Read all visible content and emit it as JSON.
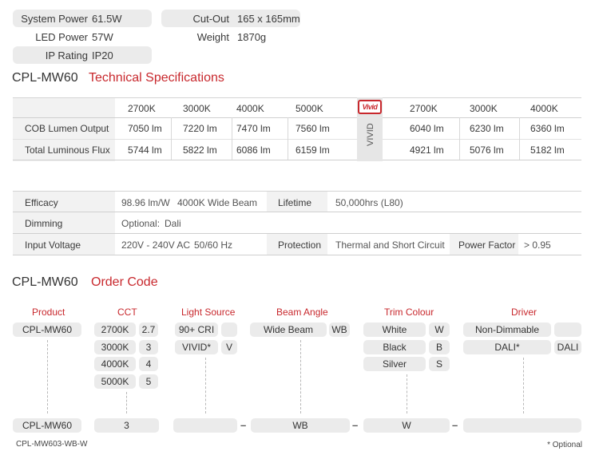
{
  "summary": {
    "system_power_label": "System Power",
    "system_power_value": "61.5W",
    "led_power_label": "LED Power",
    "led_power_value": "57W",
    "ip_rating_label": "IP Rating",
    "ip_rating_value": "IP20",
    "cutout_label": "Cut-Out",
    "cutout_value": "165 x 165mm",
    "weight_label": "Weight",
    "weight_value": "1870g"
  },
  "tech": {
    "model": "CPL-MW60",
    "heading": "Technical Specifications",
    "cct_headers": [
      "2700K",
      "3000K",
      "4000K",
      "5000K"
    ],
    "vivid_logo": "Vivid",
    "vivid_label": "VIVID",
    "vivid_headers": [
      "2700K",
      "3000K",
      "4000K"
    ],
    "rows": [
      {
        "label": "COB Lumen Output",
        "values": [
          "7050 lm",
          "7220 lm",
          "7470 lm",
          "7560 lm"
        ],
        "vivid": [
          "6040 lm",
          "6230 lm",
          "6360 lm"
        ]
      },
      {
        "label": "Total Luminous Flux",
        "values": [
          "5744 lm",
          "5822 lm",
          "6086 lm",
          "6159 lm"
        ],
        "vivid": [
          "4921 lm",
          "5076 lm",
          "5182 lm"
        ]
      }
    ]
  },
  "perf": {
    "efficacy_label": "Efficacy",
    "efficacy_value": "98.96 lm/W",
    "efficacy_note": "4000K Wide Beam",
    "lifetime_label": "Lifetime",
    "lifetime_value": "50,000hrs (L80)",
    "dimming_label": "Dimming",
    "dimming_value": "Optional:",
    "dimming_option": "Dali",
    "input_label": "Input Voltage",
    "input_value": "220V - 240V AC",
    "input_freq": "50/60 Hz",
    "protection_label": "Protection",
    "protection_value": "Thermal and Short Circuit",
    "pf_label": "Power Factor",
    "pf_value": "> 0.95"
  },
  "order": {
    "model": "CPL-MW60",
    "heading": "Order Code",
    "columns": {
      "product": "Product",
      "cct": "CCT",
      "light_source": "Light Source",
      "beam_angle": "Beam Angle",
      "trim_colour": "Trim Colour",
      "driver": "Driver"
    },
    "product_item": "CPL-MW60",
    "cct_items": [
      {
        "label": "2700K",
        "code": "2.7"
      },
      {
        "label": "3000K",
        "code": "3"
      },
      {
        "label": "4000K",
        "code": "4"
      },
      {
        "label": "5000K",
        "code": "5"
      }
    ],
    "light_items": [
      {
        "label": "90+ CRI",
        "code": ""
      },
      {
        "label": "VIVID*",
        "code": "V"
      }
    ],
    "beam_items": [
      {
        "label": "Wide Beam",
        "code": "WB"
      }
    ],
    "trim_items": [
      {
        "label": "White",
        "code": "W"
      },
      {
        "label": "Black",
        "code": "B"
      },
      {
        "label": "Silver",
        "code": "S"
      }
    ],
    "driver_items": [
      {
        "label": "Non-Dimmable",
        "code": ""
      },
      {
        "label": "DALI*",
        "code": "DALI"
      }
    ],
    "result": {
      "product": "CPL-MW60",
      "cct": "3",
      "light": "",
      "sep1": "–",
      "beam": "WB",
      "sep2": "–",
      "trim": "W",
      "sep3": "–",
      "driver": ""
    },
    "example": "CPL-MW603-WB-W",
    "footnote": "* Optional"
  }
}
